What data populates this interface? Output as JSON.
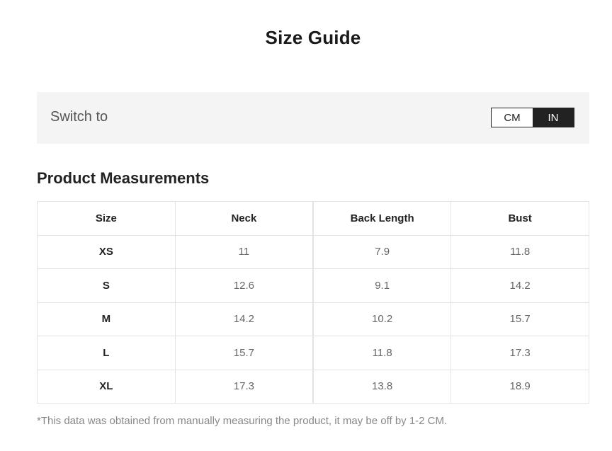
{
  "page": {
    "title": "Size Guide"
  },
  "switch": {
    "label": "Switch to",
    "options": [
      "CM",
      "IN"
    ],
    "selected": "IN"
  },
  "measurements": {
    "title": "Product Measurements",
    "columns": [
      "Size",
      "Neck",
      "Back Length",
      "Bust"
    ],
    "rows": [
      [
        "XS",
        "11",
        "7.9",
        "11.8"
      ],
      [
        "S",
        "12.6",
        "9.1",
        "14.2"
      ],
      [
        "M",
        "14.2",
        "10.2",
        "15.7"
      ],
      [
        "L",
        "15.7",
        "11.8",
        "17.3"
      ],
      [
        "XL",
        "17.3",
        "13.8",
        "18.9"
      ]
    ]
  },
  "footnote": "*This data was obtained from manually measuring the product, it may be off by 1-2 CM.",
  "colors": {
    "active_toggle_bg": "#222222",
    "switch_bar_bg": "#f4f4f4",
    "table_border": "#e3e3e3"
  }
}
